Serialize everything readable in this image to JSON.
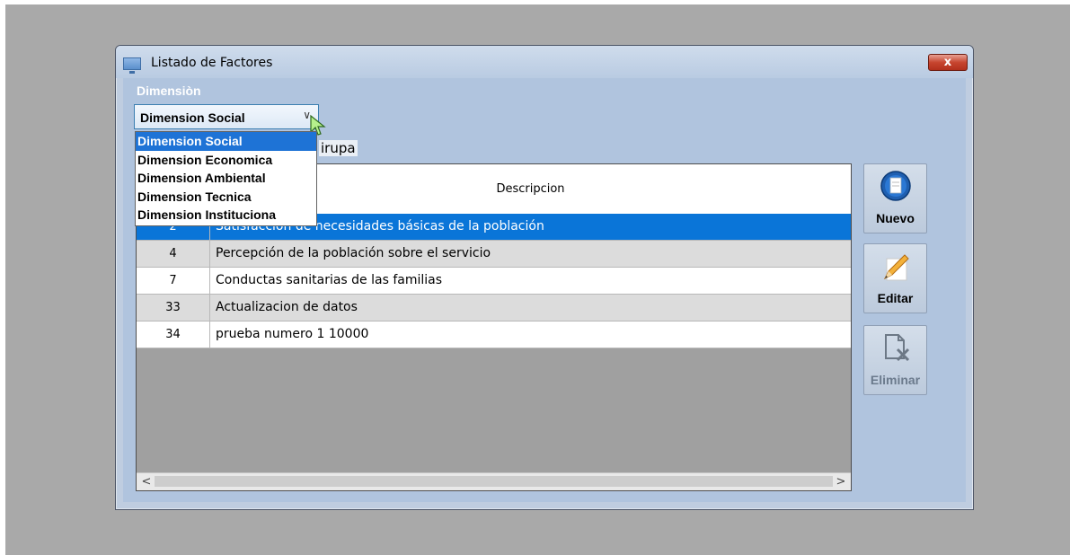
{
  "window": {
    "title": "Listado de Factores",
    "close_label": "x"
  },
  "dimension": {
    "label": "Dimensiòn",
    "selected": "Dimension Social",
    "options": [
      "Dimension Social",
      "Dimension Economica",
      "Dimension Ambiental",
      "Dimension Tecnica",
      "Dimension Instituciona"
    ]
  },
  "partial_label": "irupa",
  "table": {
    "header_num": "",
    "header_desc": "Descripcion",
    "rows": [
      {
        "num": "2",
        "desc": "Satisfacción de necesidades básicas de la  población",
        "selected": true
      },
      {
        "num": "4",
        "desc": "Percepción de la población sobre el servicio"
      },
      {
        "num": "7",
        "desc": "Conductas sanitarias de las familias"
      },
      {
        "num": "33",
        "desc": "Actualizacion de datos"
      },
      {
        "num": "34",
        "desc": "prueba numero 1 10000"
      }
    ]
  },
  "scrollbar": {
    "left_arrow": "<",
    "right_arrow": ">"
  },
  "buttons": {
    "nuevo": "Nuevo",
    "editar": "Editar",
    "eliminar": "Eliminar"
  },
  "icons": {
    "window": "window-icon",
    "nuevo": "new-document-icon",
    "editar": "pencil-icon",
    "eliminar": "delete-document-icon"
  },
  "colors": {
    "selection": "#0a75d8",
    "window_bg": "#b0c4de",
    "close_button": "#c7452f"
  }
}
